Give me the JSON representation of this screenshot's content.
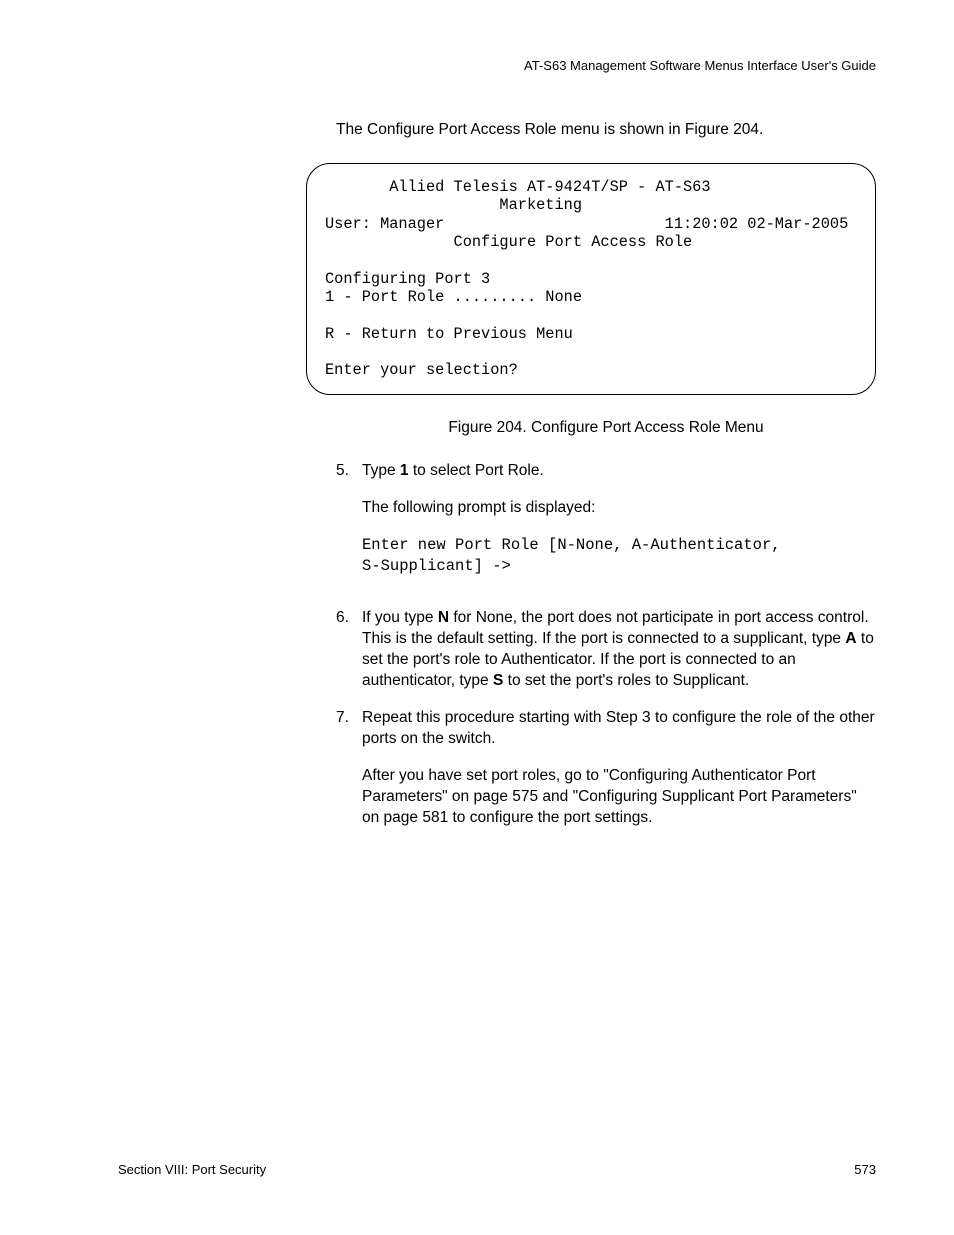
{
  "header": {
    "guide_title": "AT-S63 Management Software Menus Interface User's Guide"
  },
  "intro": "The Configure Port Access Role menu is shown in Figure 204.",
  "terminal": {
    "line1": "       Allied Telesis AT-9424T/SP - AT-S63",
    "line2": "                   Marketing",
    "user_left": "User: Manager",
    "user_right": "11:20:02 02-Mar-2005",
    "menu_title": "              Configure Port Access Role",
    "blank": "",
    "cfg1": "Configuring Port 3",
    "cfg2": "1 - Port Role ......... None",
    "cfg3": "R - Return to Previous Menu",
    "cfg4": "Enter your selection?"
  },
  "figure_caption": "Figure 204. Configure Port Access Role Menu",
  "steps": {
    "s5": {
      "num": "5.",
      "t_pre": "Type ",
      "t_bold": "1",
      "t_post": " to select Port Role.",
      "p2": "The following prompt is displayed:",
      "code1": "Enter new Port Role [N-None, A-Authenticator,",
      "code2": "S-Supplicant] ->"
    },
    "s6": {
      "num": "6.",
      "a": "If you type ",
      "b1": "N",
      "c": " for None, the port does not participate in port access control. This is the default setting. If the port is connected to a supplicant, type ",
      "b2": "A",
      "d": " to set the port's role to Authenticator. If the port is connected to an authenticator, type ",
      "b3": "S",
      "e": " to set the port's roles to Supplicant."
    },
    "s7": {
      "num": "7.",
      "p1": "Repeat this procedure starting with Step 3 to configure the role of the other ports on the switch.",
      "p2": "After you have set port roles, go to \"Configuring Authenticator Port Parameters\" on page 575 and \"Configuring Supplicant Port Parameters\" on page 581 to configure the port settings."
    }
  },
  "footer": {
    "left": "Section VIII: Port Security",
    "right": "573"
  }
}
